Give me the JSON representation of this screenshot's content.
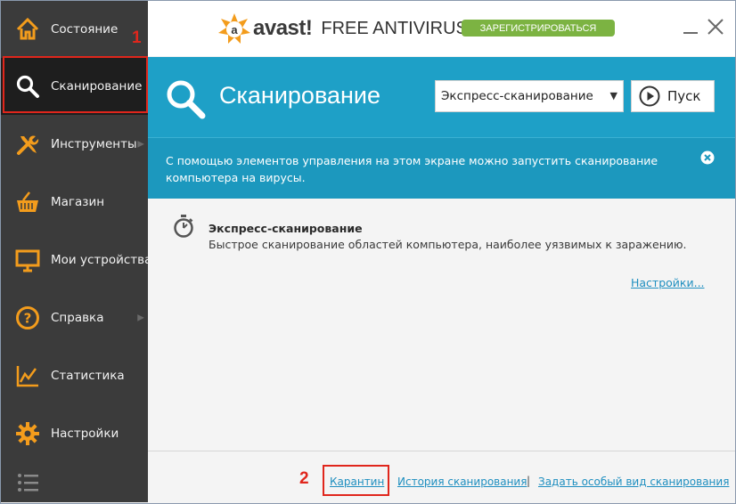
{
  "sidebar": {
    "items": [
      {
        "label": "Состояние",
        "icon": "home-icon"
      },
      {
        "label": "Сканирование",
        "icon": "search-icon"
      },
      {
        "label": "Инструменты",
        "icon": "tools-icon"
      },
      {
        "label": "Магазин",
        "icon": "basket-icon"
      },
      {
        "label": "Мои устройства",
        "icon": "monitor-icon"
      },
      {
        "label": "Справка",
        "icon": "help-icon"
      },
      {
        "label": "Статистика",
        "icon": "chart-icon"
      },
      {
        "label": "Настройки",
        "icon": "gear-icon"
      }
    ],
    "active_index": 1,
    "accent_color": "#f39c1c"
  },
  "annotations": {
    "first": "1",
    "second": "2",
    "color": "#e0261c"
  },
  "titlebar": {
    "brand": "avast!",
    "product": "FREE ANTIVIRUS",
    "register_label": "ЗАРЕГИСТРИРОВАТЬСЯ"
  },
  "header": {
    "title": "Сканирование",
    "scan_type_selected": "Экспресс-сканирование",
    "start_label": "Пуск",
    "color": "#1ea0c7"
  },
  "info": {
    "text": "С помощью элементов управления на этом экране можно запустить сканирование компьютера на вирусы."
  },
  "scan": {
    "title": "Экспресс-сканирование",
    "description": "Быстрое сканирование областей компьютера, наиболее уязвимых к заражению.",
    "settings_link": "Настройки..."
  },
  "footer": {
    "quarantine": "Карантин",
    "history": "История сканирования",
    "separator": "|",
    "custom_scan": "Задать особый вид сканирования"
  }
}
